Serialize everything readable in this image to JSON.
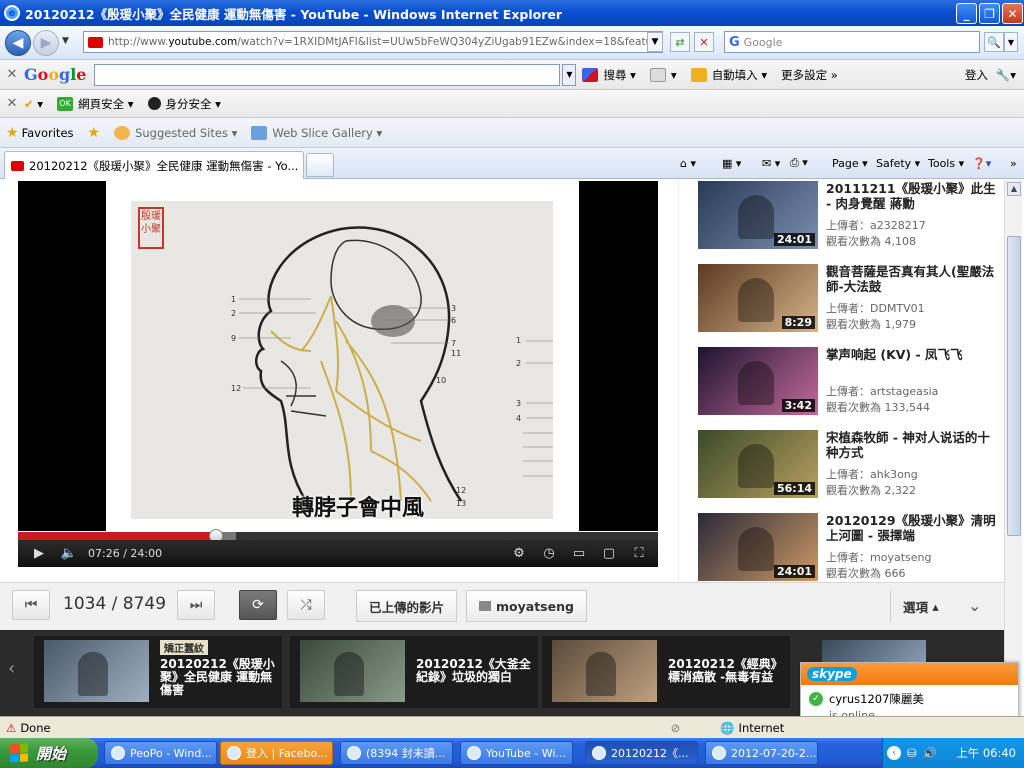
{
  "window": {
    "title": "20120212《殷瑗小聚》全民健康 運動無傷害 - YouTube - Windows Internet Explorer"
  },
  "nav": {
    "url_prefix": "http://www.",
    "url_domain": "youtube.com",
    "url_rest": "/watch?v=1RXIDMtJAFI&list=UUw5bFeWQ304yZiUgab91EZw&index=18&feature=plcp",
    "search_placeholder": "Google"
  },
  "google_toolbar": {
    "logo": "Google",
    "search_label": "搜尋",
    "autofill_label": "自動填入",
    "more_settings": "更多設定 »",
    "login": "登入"
  },
  "security_toolbar": {
    "web_security": "網頁安全",
    "identity_security": "身分安全"
  },
  "favorites_bar": {
    "favorites": "Favorites",
    "suggested_sites": "Suggested Sites",
    "web_slice": "Web Slice Gallery"
  },
  "tab": {
    "label": "20120212《殷瑗小聚》全民健康 運動無傷害 - Yo..."
  },
  "command_bar": {
    "page": "Page",
    "safety": "Safety",
    "tools": "Tools"
  },
  "video": {
    "caption": "轉脖子會中風",
    "seal_text": "殷瑗小聚",
    "current_time": "07:26",
    "duration": "24:00",
    "progress_fraction": 0.31,
    "buffered_fraction": 0.34
  },
  "related": [
    {
      "title": "20111211《殷瑗小聚》此生 - 肉身覺醒 蔣勳",
      "uploader": "上傳者：a2328217",
      "views": "觀看次數為 4,108",
      "duration": "24:01"
    },
    {
      "title": "觀音菩薩是否真有其人(聖嚴法師-大法鼓",
      "uploader": "上傳者：DDMTV01",
      "views": "觀看次數為 1,979",
      "duration": "8:29"
    },
    {
      "title": "掌声响起 (KV) - 凤飞飞",
      "uploader": "上傳者：artstageasia",
      "views": "觀看次數為 133,544",
      "duration": "3:42"
    },
    {
      "title": "宋植森牧師 - 神对人说话的十种方式",
      "uploader": "上傳者：ahk3ong",
      "views": "觀看次數為 2,322",
      "duration": "56:14"
    },
    {
      "title": "20120129《殷瑗小聚》清明上河圖 - 張擇端",
      "uploader": "上傳者：moyatseng",
      "views": "觀看次數為 666",
      "duration": "24:01"
    }
  ],
  "playlist": {
    "counter": "1034 / 8749",
    "uploaded_label": "已上傳的影片",
    "channel": "moyatseng",
    "options": "選項",
    "items": [
      {
        "title": "20120212《殷瑗小聚》全民健康 運動無傷害",
        "tag": "矯正蠶紋"
      },
      {
        "title": "20120212《大釜全紀錄》垃圾的獨白",
        "tag": ""
      },
      {
        "title": "20120212《經典》標消癌散 -無毒有益",
        "tag": ""
      }
    ]
  },
  "status": {
    "text": "Done",
    "zone": "Internet"
  },
  "skype": {
    "brand": "skype",
    "user": "cyrus1207陳麗美",
    "status": "is online"
  },
  "taskbar": {
    "start": "開始",
    "clock": "上午 06:40",
    "items": [
      {
        "label": "PeoPo - Wind..."
      },
      {
        "label": "登入 | Facebo..."
      },
      {
        "label": "(8394 封未讀..."
      },
      {
        "label": "YouTube - Wi..."
      },
      {
        "label": "20120212《..."
      },
      {
        "label": "2012-07-20-2..."
      }
    ]
  },
  "colors": {
    "yt_red": "#cc181e",
    "titlebar": "#0a4fd0",
    "taskbar": "#225ad3",
    "start_green": "#3a9a3a"
  }
}
